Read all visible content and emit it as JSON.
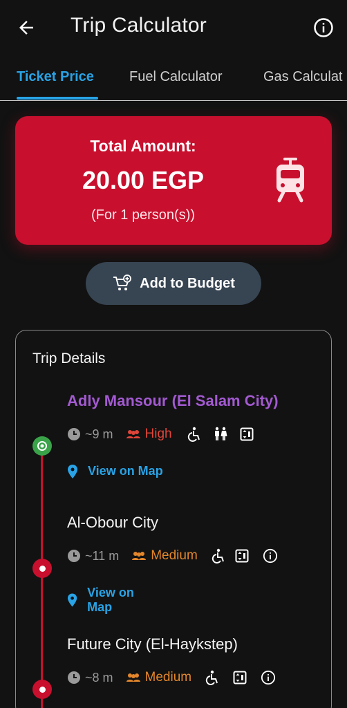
{
  "appbar": {
    "title": "Trip Calculator",
    "back_icon": "arrow-left-icon",
    "info_icon": "info-icon"
  },
  "tabs": [
    {
      "label": "Ticket Price",
      "active": true
    },
    {
      "label": "Fuel Calculator",
      "active": false
    },
    {
      "label": "Gas Calculat",
      "active": false
    }
  ],
  "total": {
    "label": "Total Amount:",
    "value": "20.00 EGP",
    "persons": "(For 1 person(s))",
    "icon": "tram-icon",
    "color": "#c8102e"
  },
  "budget_button": {
    "label": "Add to Budget",
    "icon": "cart-add-icon"
  },
  "trip_details": {
    "title": "Trip Details",
    "line_color": "#c8102e",
    "stations": [
      {
        "name": "Adly Mansour (El Salam City)",
        "time": "~9 m",
        "crowd": "High",
        "crowd_color": "#e0453a",
        "facilities": [
          "wheelchair-icon",
          "restroom-icon",
          "elevator-icon"
        ],
        "map_link": "View on Map"
      },
      {
        "name": "Al-Obour City",
        "time": "~11 m",
        "crowd": "Medium",
        "crowd_color": "#e3862b",
        "facilities": [
          "wheelchair-icon",
          "elevator-icon",
          "info-icon"
        ],
        "map_link": "View on Map"
      },
      {
        "name": "Future City (El-Haykstep)",
        "time": "~8 m",
        "crowd": "Medium",
        "crowd_color": "#e3862b",
        "facilities": [
          "wheelchair-icon",
          "elevator-icon",
          "info-icon"
        ]
      }
    ]
  },
  "colors": {
    "accent": "#29a3e6",
    "start_dot": "#3aa349",
    "background": "#121212",
    "button": "#374452",
    "station_highlight": "#a35ad1"
  }
}
